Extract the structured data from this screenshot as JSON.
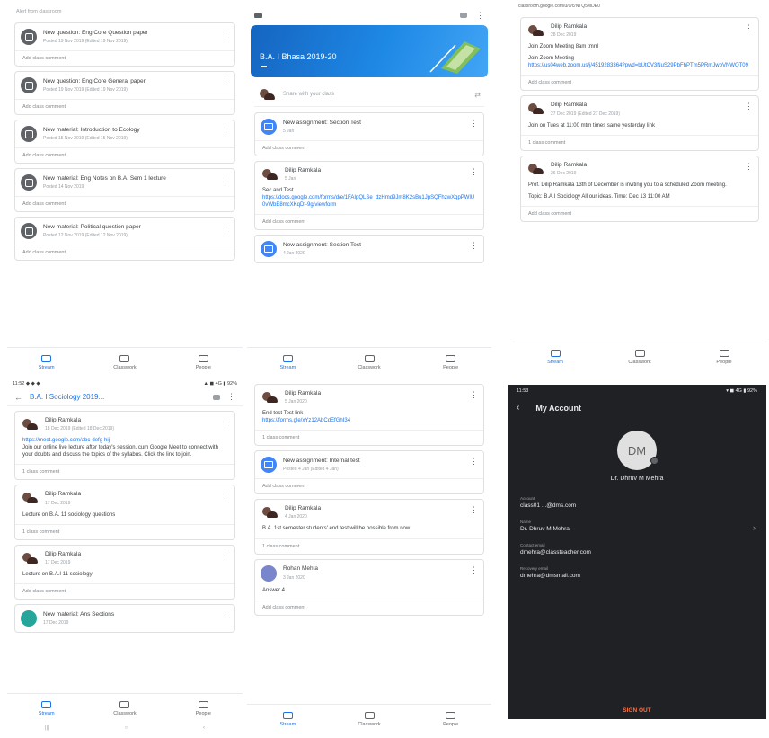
{
  "panel1": {
    "top_label": "Alert from classroom",
    "items": [
      {
        "title": "New question: Eng Core Question paper",
        "sub": "Posted 19 Nov 2019 (Edited 19 Nov 2019)",
        "footer": "Add class comment"
      },
      {
        "title": "New question: Eng Core General paper",
        "sub": "Posted 19 Nov 2019 (Edited 19 Nov 2019)",
        "footer": "Add class comment"
      },
      {
        "title": "New material: Introduction to Ecology",
        "sub": "Posted 15 Nov 2019 (Edited 15 Nov 2019)",
        "footer": "Add class comment"
      },
      {
        "title": "New material: Eng Notes on B.A. Sem 1 lecture",
        "sub": "Posted 14 Nov 2019",
        "footer": "Add class comment"
      },
      {
        "title": "New material: Political question paper",
        "sub": "Posted 12 Nov 2019 (Edited 12 Nov 2019)",
        "footer": "Add class comment"
      }
    ]
  },
  "panel2": {
    "banner_title": "B.A. I Bhasa 2019-20",
    "share_placeholder": "Share with your class",
    "posts": [
      {
        "type": "assignment",
        "title": "New assignment: Section Test",
        "sub": "5 Jan",
        "footer": "Add class comment"
      },
      {
        "type": "post",
        "author": "Dilip Ramkala",
        "date": "5 Jan",
        "text": "Sec and Test",
        "link": "https://docs.google.com/forms/d/e/1FAIpQLSe_dzHmd9Jm8K2sBu1JpSQFhzwXqpPWlU0vWbE8mcXKqDf-9g/viewform",
        "footer": "Add class comment"
      },
      {
        "type": "assignment",
        "title": "New assignment: Section Test",
        "sub": "4 Jan 2020",
        "footer": ""
      }
    ]
  },
  "panel3": {
    "urlbar": "classroom.google.com/u/0/c/NTQ5MDE0",
    "posts": [
      {
        "author": "Dilip Ramkala",
        "date": "28 Dec 2019",
        "text": "Join Zoom Meeting 8am tmrrl",
        "extra": "Join Zoom Meeting",
        "link": "https://us04web.zoom.us/j/4519283364?pwd=bUtCV3NuS29PbFhPTm5PRmJwbVNWQT09",
        "footer": "Add class comment"
      },
      {
        "author": "Dilip Ramkala",
        "date": "27 Dec 2019 (Edited 27 Dec 2019)",
        "text": "Join on Tues at 11:00 mtm times same yesterday link",
        "extra": "",
        "link": "",
        "footer": "1 class comment"
      },
      {
        "author": "Dilip Ramkala",
        "date": "26 Dec 2019",
        "text": "Prof. Dilip Ramkala 13th of December is inviting you to a scheduled Zoom meeting.",
        "extra": "Topic: B.A.I Sociology All our ideas. Time: Dec 13 11:00 AM",
        "link": "",
        "footer": "Add class comment"
      }
    ]
  },
  "panel4": {
    "statusbar": "11:52 ◆ ◆ ◆",
    "statusbar_right": "▲ ◼ 4G ▮ 92%",
    "class_title": "B.A. I Sociology 2019...",
    "posts": [
      {
        "author": "Dilip Ramkala",
        "date": "18 Dec 2019 (Edited 18 Dec 2019)",
        "link": "https://meet.google.com/abc-defg-hij",
        "text": "Join our online live lecture after today's session, cum Google Meet to connect with your doubts and discuss the topics of the syllabus. Click the link to join.",
        "footer": "1 class comment"
      },
      {
        "author": "Dilip Ramkala",
        "date": "17 Dec 2019",
        "text": "Lecture on B.A. 11 sociology questions",
        "footer": "1 class comment"
      },
      {
        "author": "Dilip Ramkala",
        "date": "17 Dec 2019",
        "text": "Lecture on B.A.I 11 sociology",
        "footer": "Add class comment"
      },
      {
        "author": "New material: Ans Sections",
        "date": "17 Dec 2019",
        "text": "",
        "footer": ""
      }
    ]
  },
  "panel5": {
    "posts": [
      {
        "type": "post",
        "author": "Dilip Ramkala",
        "date": "5 Jan 2020",
        "text": "End test Test link",
        "link": "https://forms.gle/xYz12AbCdEfGhI34",
        "footer": "1 class comment"
      },
      {
        "type": "assignment",
        "title": "New assignment: Internal test",
        "sub": "Posted 4 Jan (Edited 4 Jan)",
        "footer": "Add class comment"
      },
      {
        "type": "post",
        "author": "Dilip Ramkala",
        "date": "4 Jan 2020",
        "text": "B.A. 1st semester students' end test will be possible from now",
        "link": "",
        "footer": "1 class comment"
      },
      {
        "type": "post",
        "author": "Rohan Mehta",
        "date": "3 Jan 2020",
        "text": "Answer 4",
        "link": "",
        "footer": "Add class comment"
      }
    ]
  },
  "panel6": {
    "status_time": "11:53",
    "status_right": "▾ ◼ 4G ▮ 92%",
    "title": "My Account",
    "avatar_initials": "DM",
    "name": "Dr. Dhruv M Mehra",
    "fields": [
      {
        "label": "Account",
        "value": "class01 ...@dms.com"
      },
      {
        "label": "Name",
        "value": "Dr. Dhruv M Mehra",
        "chevron": true
      },
      {
        "label": "Contact email",
        "value": "dmehra@classteacher.com"
      },
      {
        "label": "Recovery email",
        "value": "dmehra@dmsmail.com"
      }
    ],
    "signout": "SIGN OUT"
  },
  "nav": {
    "stream": "Stream",
    "classwork": "Classwork",
    "people": "People"
  },
  "sysnav": {
    "recent": "|||",
    "home": "○",
    "back": "‹"
  },
  "colors": {
    "accent": "#1a73e8",
    "banner": "#1e88e5",
    "dark_bg": "#202124",
    "signout": "#ff7043"
  }
}
